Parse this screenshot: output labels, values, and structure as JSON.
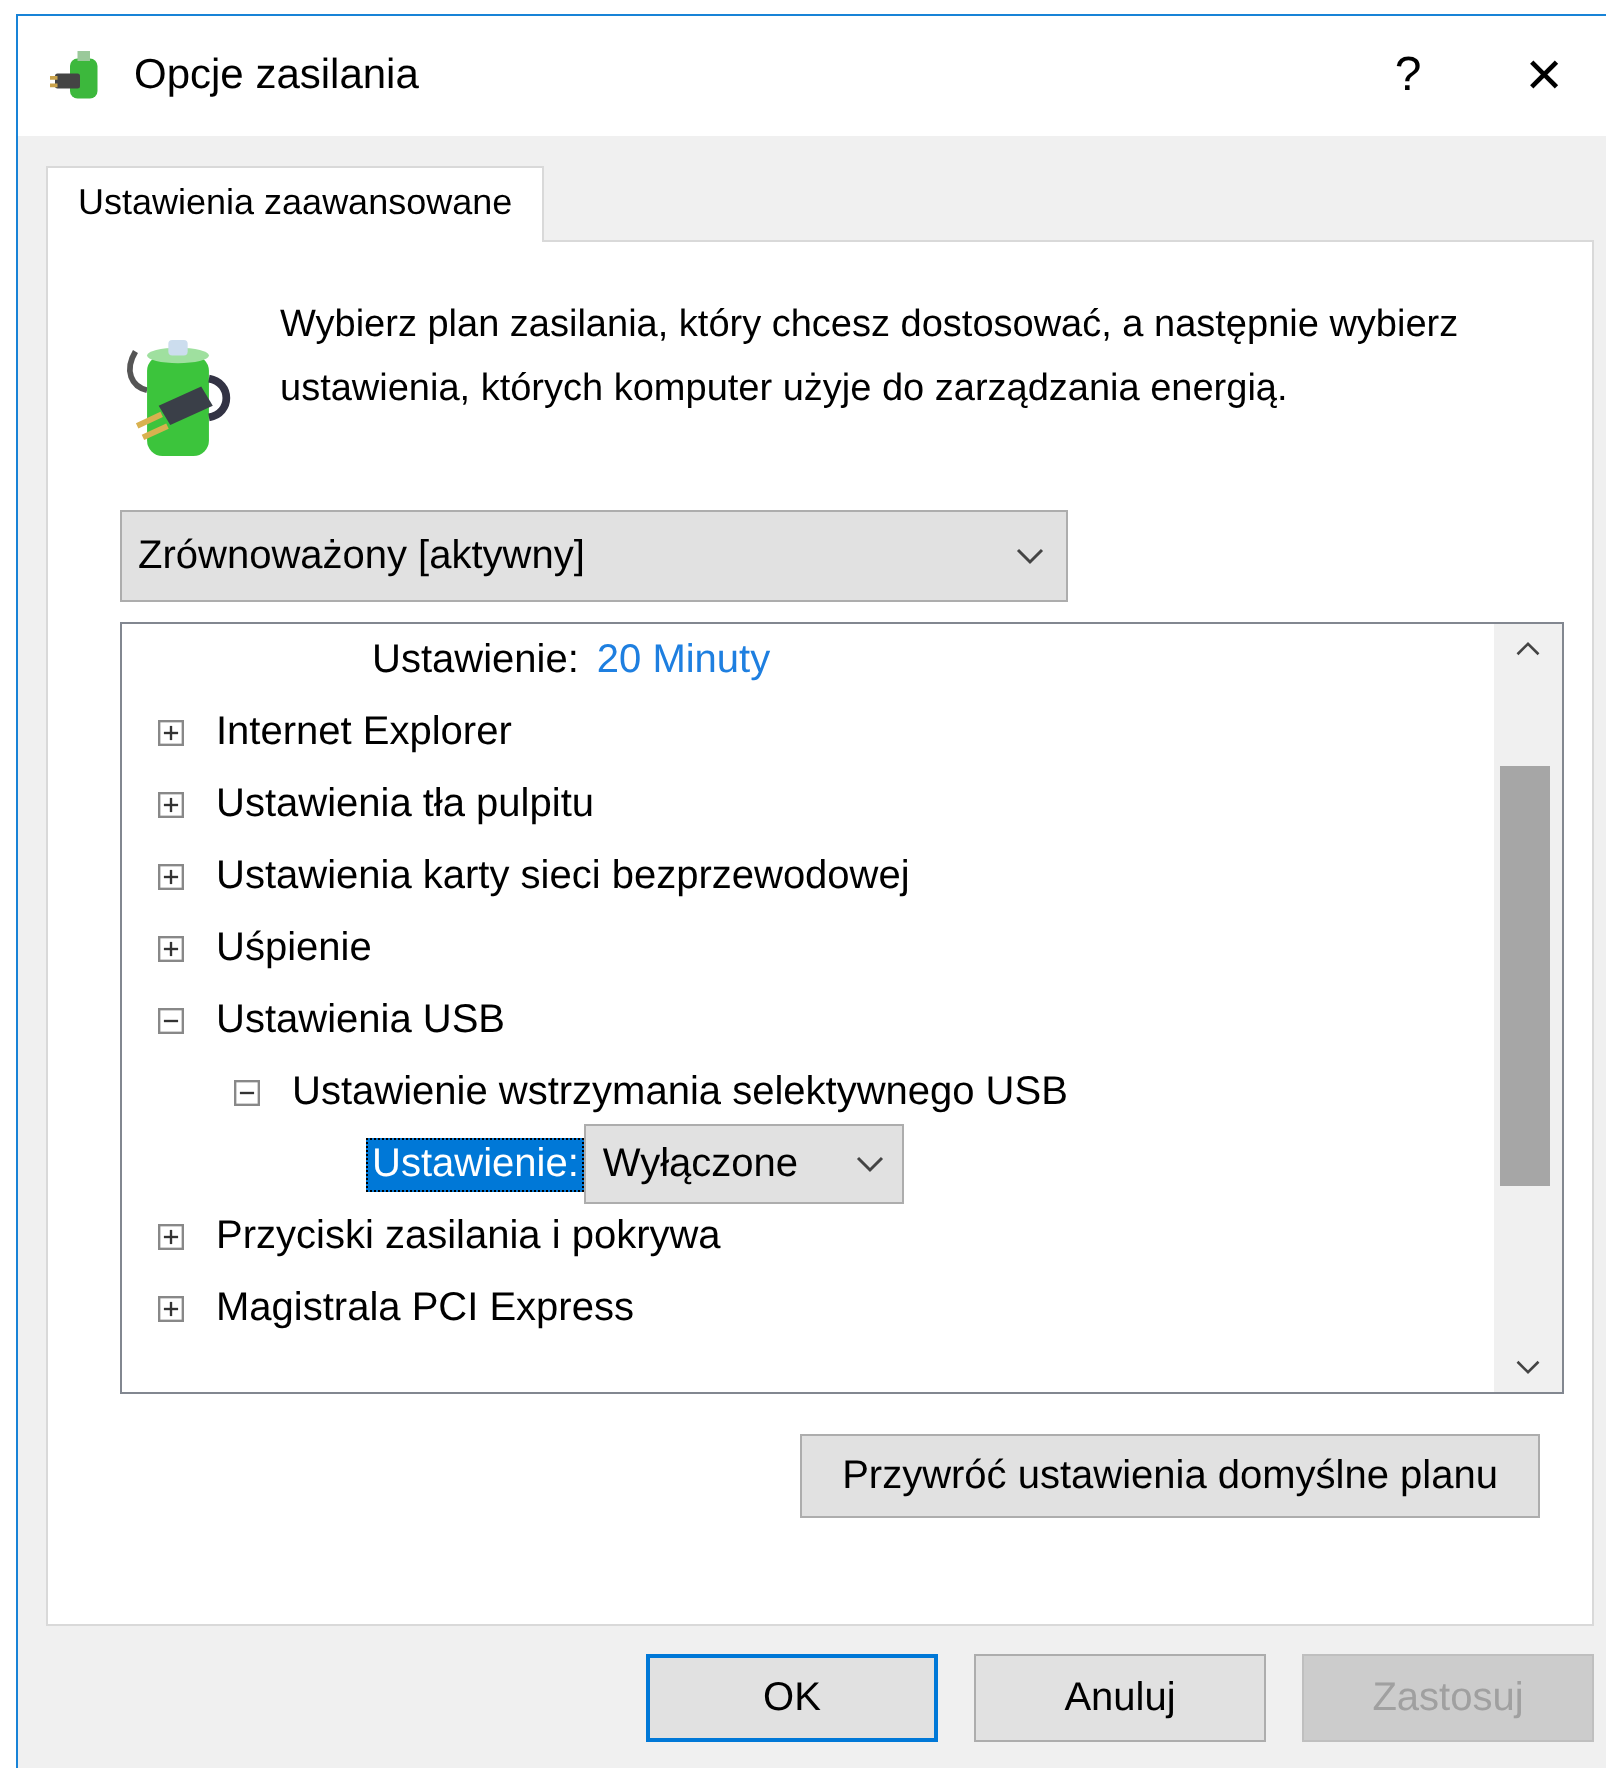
{
  "window": {
    "title": "Opcje zasilania",
    "help": "?",
    "close": "✕"
  },
  "tabs": [
    {
      "label": "Ustawienia zaawansowane",
      "selected": true
    }
  ],
  "intro": "Wybierz plan zasilania, który chcesz dostosować, a następnie wybierz ustawienia, których komputer użyje do zarządzania energią.",
  "plan_select": {
    "value": "Zrównoważony [aktywny]"
  },
  "tree": {
    "items": [
      {
        "kind": "setting",
        "label": "Ustawienie:",
        "value": "20 Minuty",
        "selected": false
      },
      {
        "kind": "group",
        "label": "Internet Explorer",
        "expanded": false,
        "selected": false
      },
      {
        "kind": "group",
        "label": "Ustawienia tła pulpitu",
        "expanded": false,
        "selected": false
      },
      {
        "kind": "group",
        "label": "Ustawienia karty sieci bezprzewodowej",
        "expanded": false,
        "selected": false
      },
      {
        "kind": "group",
        "label": "Uśpienie",
        "expanded": false,
        "selected": false
      },
      {
        "kind": "group",
        "label": "Ustawienia USB",
        "expanded": true,
        "selected": false,
        "children": [
          {
            "kind": "group",
            "label": "Ustawienie wstrzymania selektywnego USB",
            "expanded": true,
            "selected": false,
            "children": [
              {
                "kind": "select",
                "label": "Ustawienie:",
                "value": "Wyłączone",
                "selected": true
              }
            ]
          }
        ]
      },
      {
        "kind": "group",
        "label": "Przyciski zasilania i pokrywa",
        "expanded": false,
        "selected": false
      },
      {
        "kind": "group",
        "label": "Magistrala PCI Express",
        "expanded": false,
        "selected": false
      }
    ]
  },
  "restore_button": "Przywróć ustawienia domyślne planu",
  "buttons": [
    {
      "label": "OK",
      "default": true,
      "disabled": false
    },
    {
      "label": "Anuluj",
      "default": false,
      "disabled": false
    },
    {
      "label": "Zastosuj",
      "default": false,
      "disabled": true
    }
  ]
}
